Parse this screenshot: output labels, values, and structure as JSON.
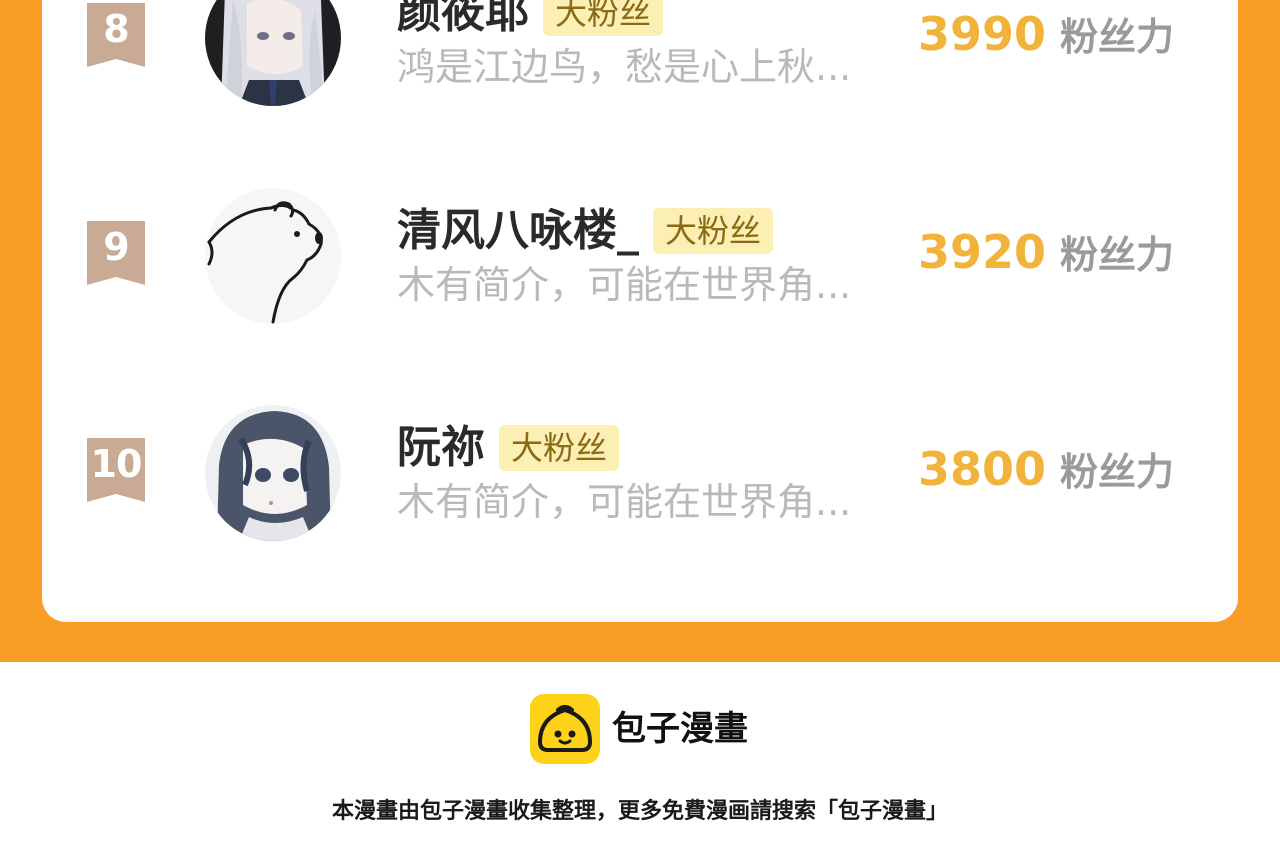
{
  "colors": {
    "orange_frame": "#f99c25",
    "score_gold": "#f2b33b",
    "badge_bg": "#fbefb3",
    "rank_ribbon": "#c8aa95",
    "logo_yellow": "#ffd21a"
  },
  "leaderboard": {
    "rows": [
      {
        "rank": "8",
        "name": "颜筱耶",
        "badge": "大粉丝",
        "bio": "鸿是江边鸟，愁是心上秋...",
        "score": "3990",
        "unit": "粉丝力",
        "avatar": "anime-girl-white-hair-avatar"
      },
      {
        "rank": "9",
        "name": "清风八咏楼_",
        "badge": "大粉丝",
        "bio": "木有简介，可能在世界角...",
        "score": "3920",
        "unit": "粉丝力",
        "avatar": "polar-bear-sketch-avatar"
      },
      {
        "rank": "10",
        "name": "阮祢",
        "badge": "大粉丝",
        "bio": "木有简介，可能在世界角...",
        "score": "3800",
        "unit": "粉丝力",
        "avatar": "anime-girl-dark-hair-avatar"
      }
    ]
  },
  "footer": {
    "brand": "包子漫畫",
    "logo_icon": "bun-logo-icon",
    "note": "本漫畫由包子漫畫收集整理，更多免費漫画請搜索「包子漫畫」"
  }
}
